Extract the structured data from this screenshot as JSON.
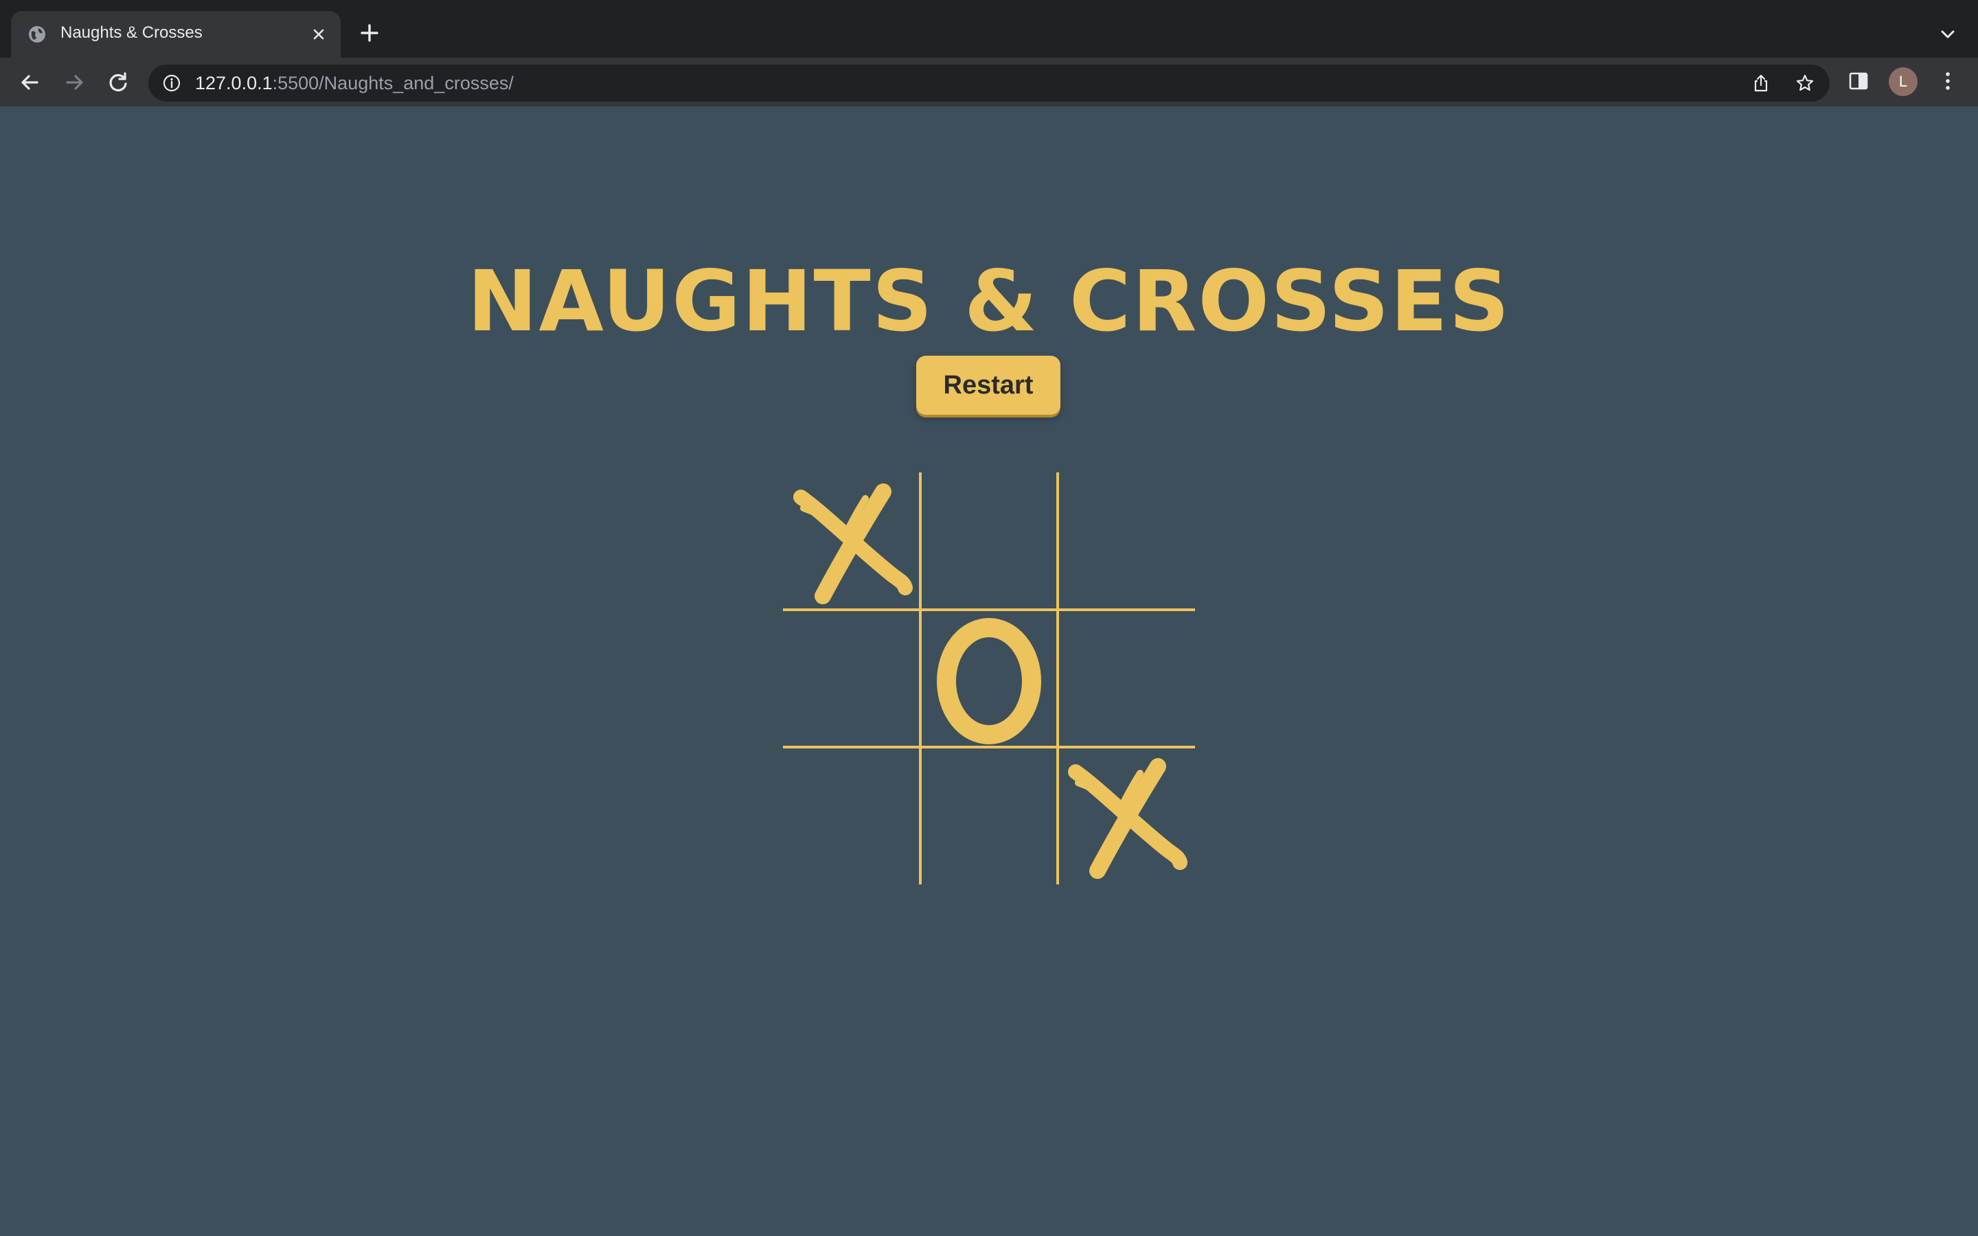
{
  "browser": {
    "tab_title": "Naughts & Crosses",
    "url_host": "127.0.0.1",
    "url_rest": ":5500/Naughts_and_crosses/",
    "profile_initial": "L",
    "icons": {
      "favicon": "globe-icon",
      "tab_close": "close-icon",
      "new_tab": "plus-icon",
      "tab_list": "chevron-down-icon",
      "back": "arrow-left-icon",
      "forward": "arrow-right-icon",
      "reload": "reload-icon",
      "site_info": "info-icon",
      "share": "share-icon",
      "bookmark": "star-icon",
      "side_panel": "side-panel-icon",
      "menu": "kebab-menu-icon"
    }
  },
  "game": {
    "title": "NAUGHTS & CROSSES",
    "restart_label": "Restart",
    "board": [
      [
        "X",
        "",
        ""
      ],
      [
        "",
        "O",
        ""
      ],
      [
        "",
        "",
        "X"
      ]
    ]
  },
  "colors": {
    "accent": "#ecc35c",
    "page_background": "#3d4f5b",
    "button_text": "#2b2b2b"
  }
}
